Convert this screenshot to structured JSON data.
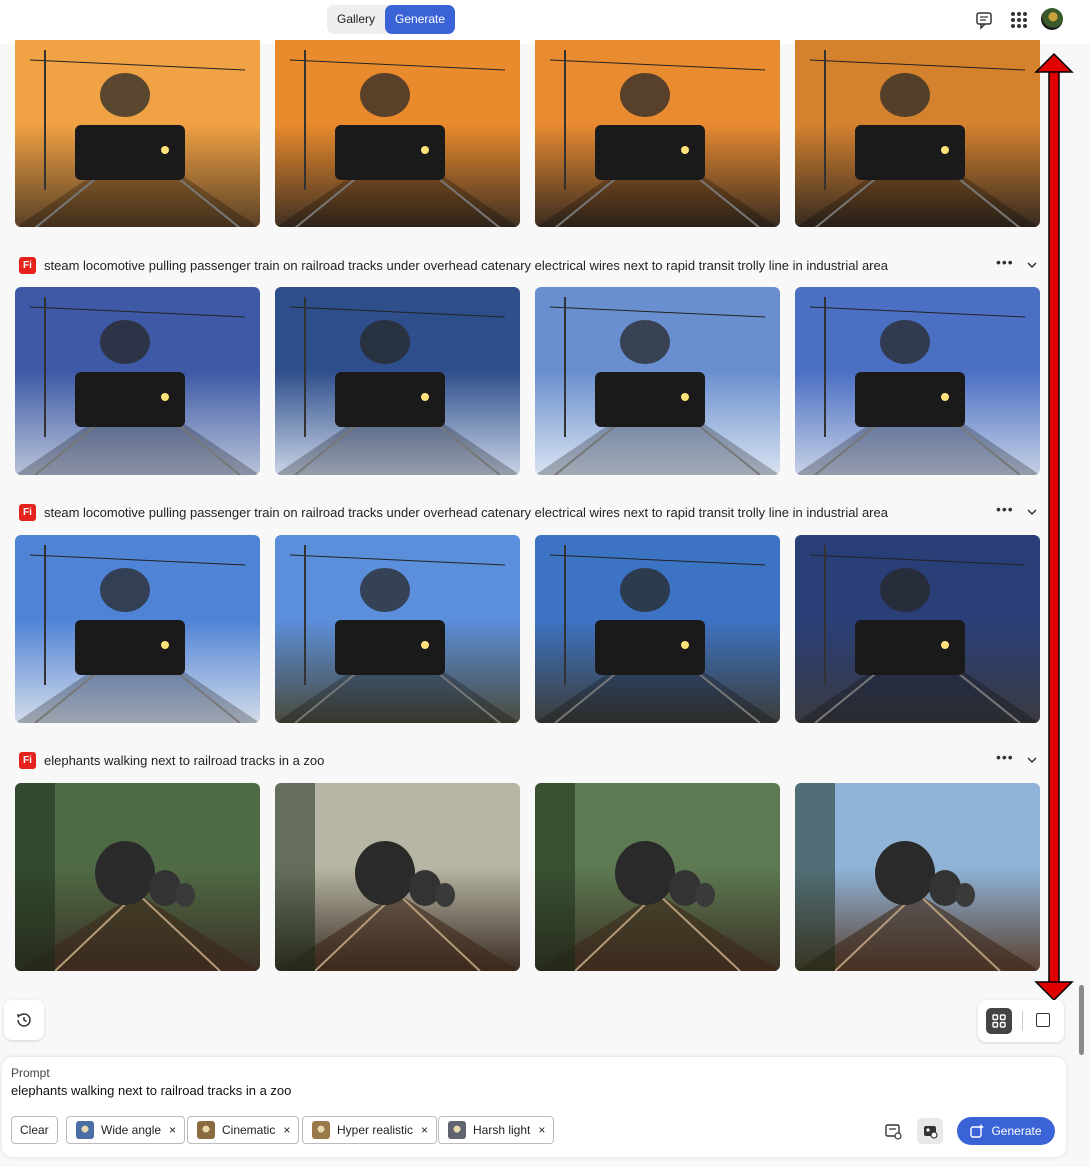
{
  "tabs": {
    "gallery": "Gallery",
    "generate": "Generate"
  },
  "icons": {
    "feedback": "feedback-icon",
    "apps": "apps-grid-icon",
    "avatar": "user-avatar",
    "firefly": "firefly-badge-icon",
    "history": "history-icon"
  },
  "badge_letter": "Fi",
  "rows": [
    {
      "caption": "",
      "thumbs": [
        {
          "name": "steam train at sunset",
          "sky": "#f0a244",
          "ground": "#5a4026"
        },
        {
          "name": "steam train at sunset",
          "sky": "#e98a2c",
          "ground": "#3f3022"
        },
        {
          "name": "steam train at sunset",
          "sky": "#e88b31",
          "ground": "#3a2c20"
        },
        {
          "name": "steam train at sunset",
          "sky": "#d5822f",
          "ground": "#352a20"
        }
      ]
    },
    {
      "caption": "steam locomotive pulling passenger train on railroad tracks under overhead catenary electrical wires next to rapid transit trolly line in industrial area",
      "thumbs": [
        {
          "name": "night train in snow",
          "sky": "#3e5aa7",
          "ground": "#b9c3d9"
        },
        {
          "name": "night train in snow",
          "sky": "#2f4f8c",
          "ground": "#c9d3e6"
        },
        {
          "name": "blue electric train",
          "sky": "#6a8fd0",
          "ground": "#d9e3f1"
        },
        {
          "name": "blue electric train",
          "sky": "#4b6fc3",
          "ground": "#c7d1e6"
        }
      ]
    },
    {
      "caption": "steam locomotive pulling passenger train on railroad tracks under overhead catenary electrical wires next to rapid transit trolly line in industrial area",
      "thumbs": [
        {
          "name": "steam train blue sky",
          "sky": "#4f83d6",
          "ground": "#d3dbe9"
        },
        {
          "name": "steam train blue sky",
          "sky": "#5b8fdb",
          "ground": "#4a4a3c"
        },
        {
          "name": "steam train blue sky",
          "sky": "#3d73c4",
          "ground": "#3c3c38"
        },
        {
          "name": "steam train night",
          "sky": "#2a3f78",
          "ground": "#3a3a40"
        }
      ]
    },
    {
      "caption": "elephants walking next to railroad tracks in a zoo",
      "thumbs": [
        {
          "name": "elephants on tracks",
          "sky": "#4f6b45",
          "ground": "#3b2f25"
        },
        {
          "name": "elephants on tracks",
          "sky": "#b7b5a4",
          "ground": "#3a2d22"
        },
        {
          "name": "elephants on tracks",
          "sky": "#5d7a52",
          "ground": "#3b2f24"
        },
        {
          "name": "elephants on tracks",
          "sky": "#8fb4d8",
          "ground": "#5a4030"
        }
      ]
    }
  ],
  "prompt": {
    "label": "Prompt",
    "value": "elephants walking next to railroad tracks in a zoo"
  },
  "clear_label": "Clear",
  "chips": [
    {
      "label": "Wide angle",
      "color": "#4a6ea5"
    },
    {
      "label": "Cinematic",
      "color": "#8a6a3e"
    },
    {
      "label": "Hyper realistic",
      "color": "#9a7a4a"
    },
    {
      "label": "Harsh light",
      "color": "#5f6470"
    }
  ],
  "remove_glyph": "×",
  "generate_label": "Generate",
  "accent": "#3b63d8",
  "arrow_color": "#e00000"
}
